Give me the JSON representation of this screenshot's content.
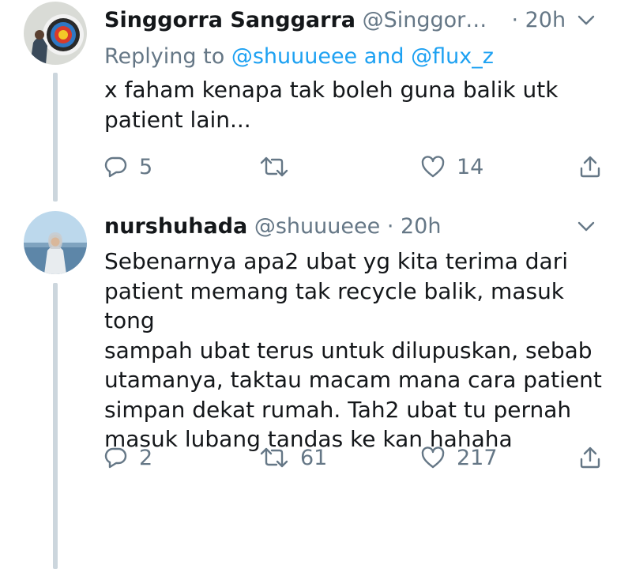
{
  "tweets": [
    {
      "author_name": "Singgorra Sanggarra",
      "handle": "@Singgor…",
      "separator": "·",
      "time": "20h",
      "replying_prefix": "Replying to ",
      "replying_user1": "@shuuueee",
      "replying_and": " and ",
      "replying_user2": "@flux_z",
      "text": "x faham kenapa tak boleh guna balik utk\npatient lain...",
      "reply_count": "5",
      "retweet_count": "",
      "like_count": "14"
    },
    {
      "author_name": "nurshuhada",
      "handle": "@shuuueee",
      "separator": "·",
      "time": "20h",
      "text": "Sebenarnya apa2 ubat yg kita terima dari\npatient memang tak recycle balik, masuk tong\nsampah ubat terus untuk dilupuskan, sebab\nutamanya, taktau macam mana cara patient\nsimpan dekat rumah. Tah2 ubat tu pernah\nmasuk lubang tandas ke kan hahaha",
      "reply_count": "2",
      "retweet_count": "61",
      "like_count": "217"
    }
  ],
  "colors": {
    "accent": "#1da1f2",
    "secondary_text": "#657786",
    "primary_text": "#14171a",
    "thread_line": "#ccd6dd"
  },
  "icons": [
    "reply-icon",
    "retweet-icon",
    "like-icon",
    "share-icon",
    "chevron-down-icon",
    "avatar-target",
    "avatar-person"
  ]
}
